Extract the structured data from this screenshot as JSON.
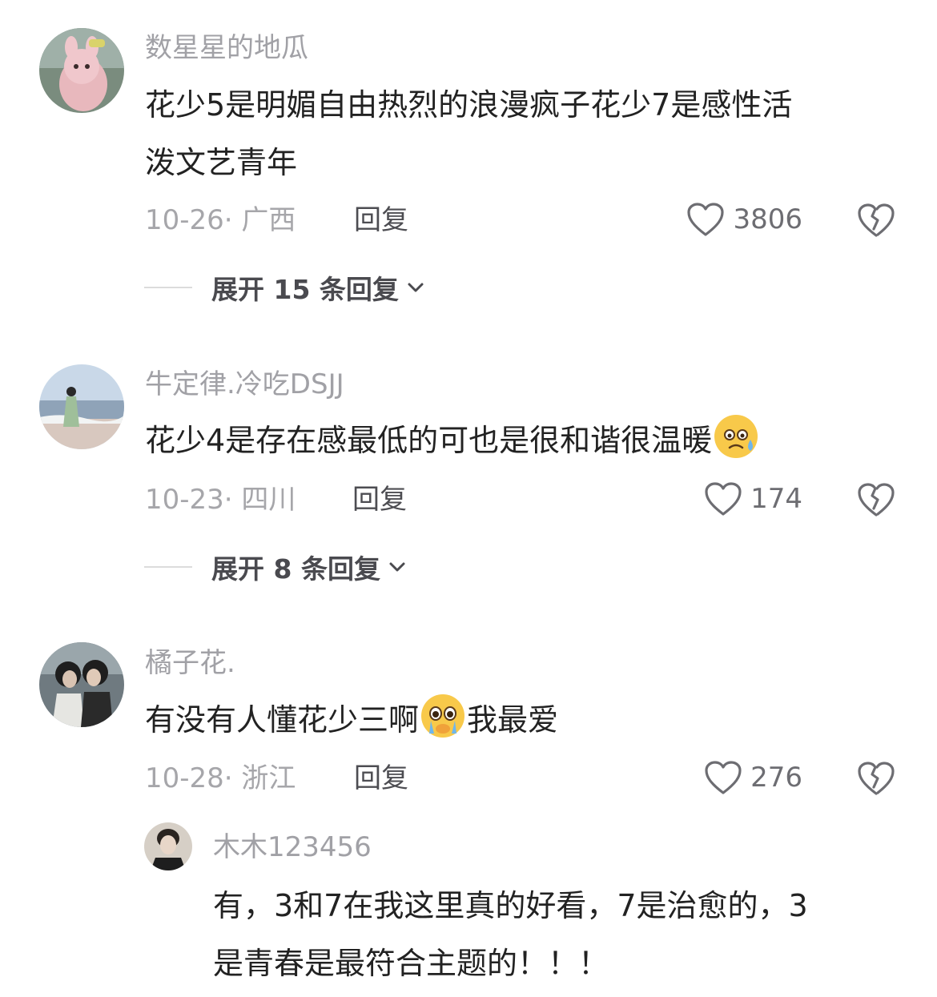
{
  "comments": [
    {
      "username": "数星星的地瓜",
      "text_line1": "花少5是明媚自由热烈的浪漫疯子花少7是感性活",
      "text_line2": "泼文艺青年",
      "date": "10-26",
      "separator": "·",
      "location": "广西",
      "reply_label": "回复",
      "likes": "3806",
      "expand_label": "展开 15 条回复"
    },
    {
      "username": "牛定律.冷吃DSJJ",
      "text": "花少4是存在感最低的可也是很和谐很温暖",
      "emoji": "sweat-smile-emoji",
      "date": "10-23",
      "separator": "·",
      "location": "四川",
      "reply_label": "回复",
      "likes": "174",
      "expand_label": "展开 8 条回复"
    },
    {
      "username": "橘子花.",
      "text_before": "有没有人懂花少三啊",
      "emoji": "crying-face-emoji",
      "text_after": "我最爱",
      "date": "10-28",
      "separator": "·",
      "location": "浙江",
      "reply_label": "回复",
      "likes": "276",
      "sub_reply": {
        "username": "木木123456",
        "text_line1": "有，3和7在我这里真的好看，7是治愈的，3",
        "text_line2": "是青春是最符合主题的！！！"
      }
    }
  ],
  "colors": {
    "username": "#a1a1a6",
    "body": "#222222",
    "meta": "#a6a6aa",
    "reply": "#4d4d52",
    "icon": "#6d6d72"
  }
}
